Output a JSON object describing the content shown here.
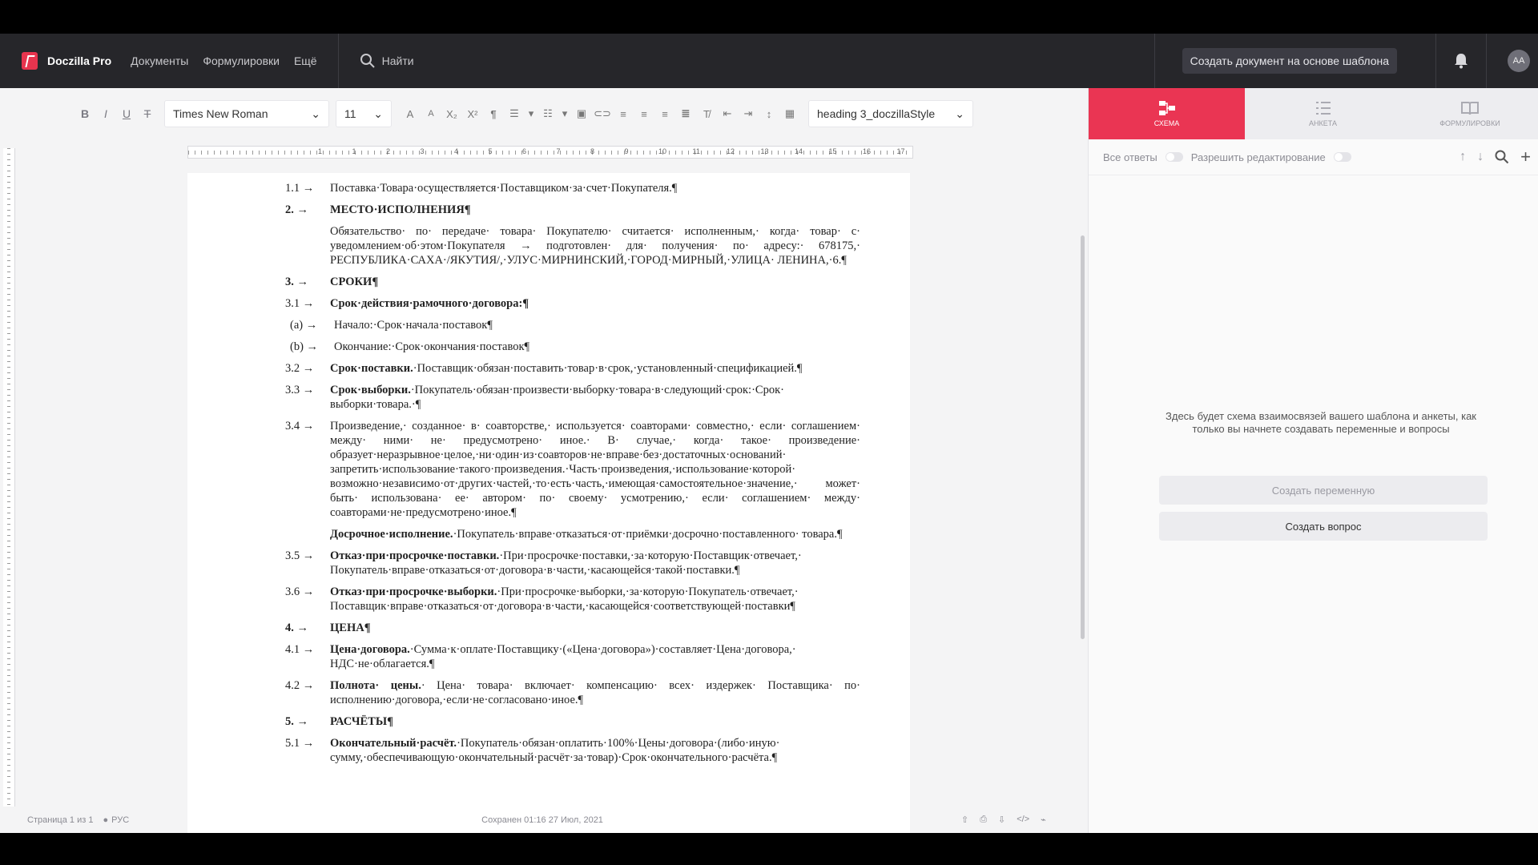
{
  "app": {
    "name": "Doczilla Pro"
  },
  "nav": {
    "items": [
      "Документы",
      "Формулировки",
      "Ещё"
    ],
    "search_label": "Найти",
    "create_template_button": "Создать документ на основе шаблона",
    "avatar_initials": "AA"
  },
  "toolbar": {
    "font_family": "Times New Roman",
    "font_size": "11",
    "style": "heading 3_doczillaStyle"
  },
  "panel": {
    "tabs": [
      {
        "label": "СХЕМА",
        "active": true
      },
      {
        "label": "АНКЕТА",
        "active": false
      },
      {
        "label": "ФОРМУЛИРОВКИ",
        "active": false
      }
    ],
    "all_answers_label": "Все ответы",
    "allow_edit_label": "Разрешить редактирование",
    "empty_message": "Здесь будет схема взаимосвязей вашего шаблона и анкеты, как только вы начнете создавать переменные и вопросы",
    "create_variable_button": "Создать переменную",
    "create_question_button": "Создать вопрос"
  },
  "ruler": {
    "labels": [
      "1",
      "1",
      "2",
      "3",
      "4",
      "5",
      "6",
      "7",
      "8",
      "9",
      "10",
      "11",
      "12",
      "13",
      "14",
      "15",
      "16",
      "17"
    ]
  },
  "document": {
    "paragraphs": [
      {
        "num": "1.1",
        "arrow": "→",
        "text": "Поставка·Товара·осуществляется·Поставщиком·за·счет·Покупателя.¶"
      },
      {
        "num": "2.",
        "arrow": "→",
        "bold": "МЕСТО·ИСПОЛНЕНИЯ¶"
      },
      {
        "text": "Обязательство· по· передаче· товара· Покупателю· считается· исполненным,· когда· товар· с· уведомлением·об·этом·Покупателя → подготовлен· для· получения· по· адресу:· 678175,· РЕСПУБЛИКА·САХА·/ЯКУТИЯ/,·УЛУС·МИРНИНСКИЙ,·ГОРОД·МИРНЫЙ,·УЛИЦА· ЛЕНИНА,·6.¶"
      },
      {
        "num": "3.",
        "arrow": "→",
        "bold": "СРОКИ¶"
      },
      {
        "num": "3.1",
        "arrow": "→",
        "bold": "Срок·действия·рамочного·договора:¶"
      },
      {
        "num": "(a)",
        "arrow": "→",
        "text": "Начало:·Срок·начала·поставок¶"
      },
      {
        "num": "(b)",
        "arrow": "→",
        "text": "Окончание:·Срок·окончания·поставок¶"
      },
      {
        "num": "3.2",
        "arrow": "→",
        "bold": "Срок·поставки.",
        "text": "·Поставщик·обязан·поставить·товар·в·срок,·установленный·спецификацией.¶"
      },
      {
        "num": "3.3",
        "arrow": "→",
        "bold": "Срок·выборки.",
        "text": "·Покупатель·обязан·произвести·выборку·товара·в·следующий·срок:·Срок· выборки·товара.·¶"
      },
      {
        "num": "3.4",
        "arrow": "→",
        "text": "Произведение,· созданное· в· соавторстве,· используется· соавторами· совместно,· если· соглашением· между· ними· не· предусмотрено· иное.· В· случае,· когда· такое· произведение· образует·неразрывное·целое,·ни·один·из·соавторов·не·вправе·без·достаточных·оснований· запретить·использование·такого·произведения.·Часть·произведения,·использование·которой· возможно·независимо·от·других·частей,·то·есть·часть,·имеющая·самостоятельное·значение,· может· быть· использована· ее· автором· по· своему· усмотрению,· если· соглашением· между· соавторами·не·предусмотрено·иное.¶"
      },
      {
        "bold": "Досрочное·исполнение.",
        "text": "·Покупатель·вправе·отказаться·от·приёмки·досрочно·поставленного· товара.¶"
      },
      {
        "num": "3.5",
        "arrow": "→",
        "bold": "Отказ·при·просрочке·поставки.",
        "text": "·При·просрочке·поставки,·за·которую·Поставщик·отвечает,· Покупатель·вправе·отказаться·от·договора·в·части,·касающейся·такой·поставки.¶"
      },
      {
        "num": "3.6",
        "arrow": "→",
        "bold": "Отказ·при·просрочке·выборки.",
        "text": "·При·просрочке·выборки,·за·которую·Покупатель·отвечает,· Поставщик·вправе·отказаться·от·договора·в·части,·касающейся·соответствующей·поставки¶"
      },
      {
        "num": "4.",
        "arrow": "→",
        "bold": "ЦЕНА¶"
      },
      {
        "num": "4.1",
        "arrow": "→",
        "bold": "Цена·договора.",
        "text": "·Сумма·к·оплате·Поставщику·(«Цена·договора»)·составляет·Цена·договора,· НДС·не·облагается.¶"
      },
      {
        "num": "4.2",
        "arrow": "→",
        "bold": "Полнота· цены.",
        "text": "· Цена· товара· включает· компенсацию· всех· издержек· Поставщика· по· исполнению·договора,·если·не·согласовано·иное.¶"
      },
      {
        "num": "5.",
        "arrow": "→",
        "bold": "РАСЧЁТЫ¶"
      },
      {
        "num": "5.1",
        "arrow": "→",
        "bold": "Окончательный·расчёт.",
        "text": "·Покупатель·обязан·оплатить·100%·Цены·договора·(либо·иную· сумму,·обеспечивающую·окончательный·расчёт·за·товар)·Срок·окончательного·расчёта.¶"
      }
    ]
  },
  "status": {
    "page": "Страница 1 из 1",
    "lang": "РУС",
    "saved": "Сохранен 01:16 27 Июл, 2021"
  },
  "colors": {
    "accent": "#ea3553",
    "nav_bg": "#26262a"
  }
}
